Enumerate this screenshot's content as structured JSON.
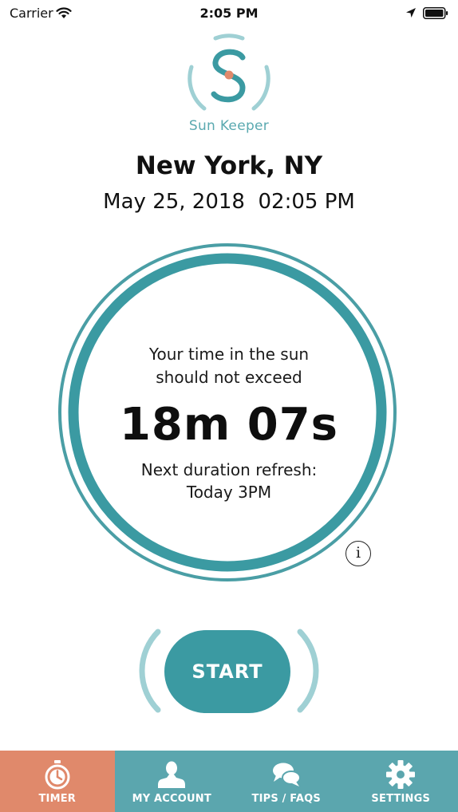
{
  "status_bar": {
    "carrier": "Carrier",
    "time": "2:05 PM",
    "wifi_icon": "wifi-icon",
    "location_icon": "location-arrow-icon",
    "battery_icon": "battery-icon"
  },
  "app": {
    "brand_name": "Sun Keeper",
    "logo_icon": "sun-keeper-logo",
    "accent_color": "#3b9aa2",
    "ring_color": "#4a9ea5",
    "active_tab_color": "#e0896b",
    "tab_bar_color": "#5ba6ae"
  },
  "location": {
    "city": "New York, NY",
    "datetime": "May 25, 2018  02:05 PM"
  },
  "timer": {
    "limit_line1": "Your time in the sun",
    "limit_line2": "should not exceed",
    "duration": "18m 07s",
    "refresh_line1": "Next duration refresh:",
    "refresh_line2": "Today 3PM",
    "info_label": "i"
  },
  "actions": {
    "start_label": "START"
  },
  "tabs": [
    {
      "label": "TIMER",
      "icon": "stopwatch-icon",
      "active": true
    },
    {
      "label": "MY ACCOUNT",
      "icon": "user-icon",
      "active": false
    },
    {
      "label": "TIPS / FAQS",
      "icon": "chat-bubbles-icon",
      "active": false
    },
    {
      "label": "SETTINGS",
      "icon": "gear-icon",
      "active": false
    }
  ]
}
